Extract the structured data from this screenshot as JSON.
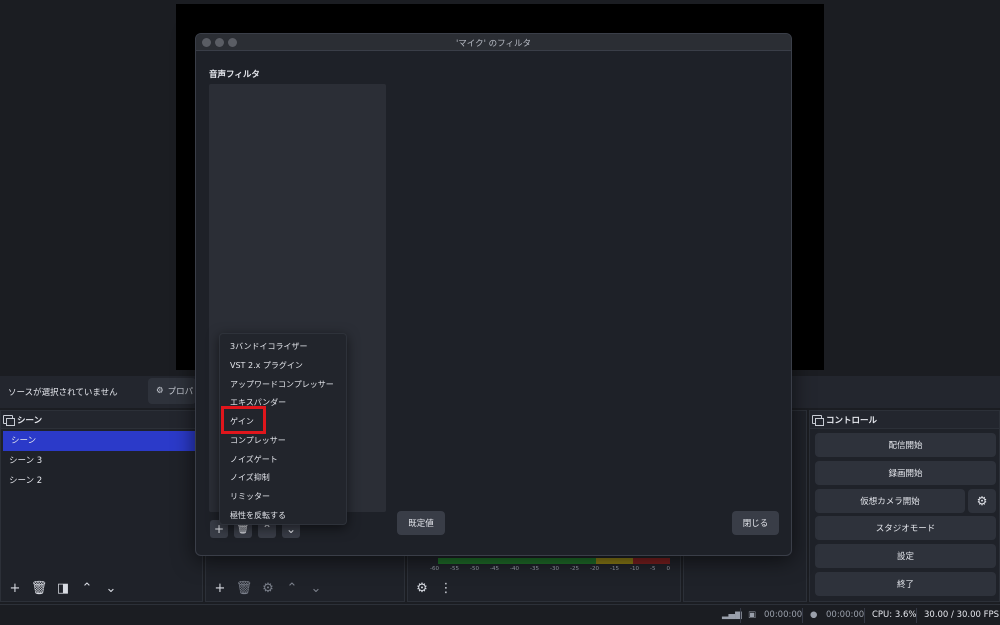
{
  "source_bar": {
    "no_source_text": "ソースが選択されていません",
    "properties_label": "プロパ"
  },
  "docks": {
    "scenes": {
      "title": "シーン",
      "items": [
        "シーン",
        "シーン 3",
        "シーン 2"
      ],
      "selected_index": 0
    },
    "controls": {
      "title": "コントロール",
      "buttons": {
        "stream": "配信開始",
        "record": "録画開始",
        "virtual_camera": "仮想カメラ開始",
        "studio": "スタジオモード",
        "settings": "設定",
        "exit": "終了"
      }
    },
    "mixer": {
      "ticks": [
        "-60",
        "-55",
        "-50",
        "-45",
        "-40",
        "-35",
        "-30",
        "-25",
        "-20",
        "-15",
        "-10",
        "-5",
        "0"
      ]
    }
  },
  "status_bar": {
    "rec_time": "00:00:00",
    "stream_time": "00:00:00",
    "cpu": "CPU: 3.6%",
    "fps": "30.00 / 30.00 FPS"
  },
  "dialog": {
    "title": "'マイク' のフィルタ",
    "audio_filters_label": "音声フィルタ",
    "defaults_button": "既定値",
    "close_button": "閉じる"
  },
  "filter_menu": {
    "items": [
      "3バンドイコライザー",
      "VST 2.x プラグイン",
      "アップワードコンプレッサー",
      "エキスパンダー",
      "ゲイン",
      "コンプレッサー",
      "ノイズゲート",
      "ノイズ抑制",
      "リミッター",
      "極性を反転する"
    ],
    "highlighted": "ゲイン"
  },
  "colors": {
    "selection": "#2b3ac9",
    "highlight_box": "#e0161c",
    "background": "#1b1d22"
  }
}
